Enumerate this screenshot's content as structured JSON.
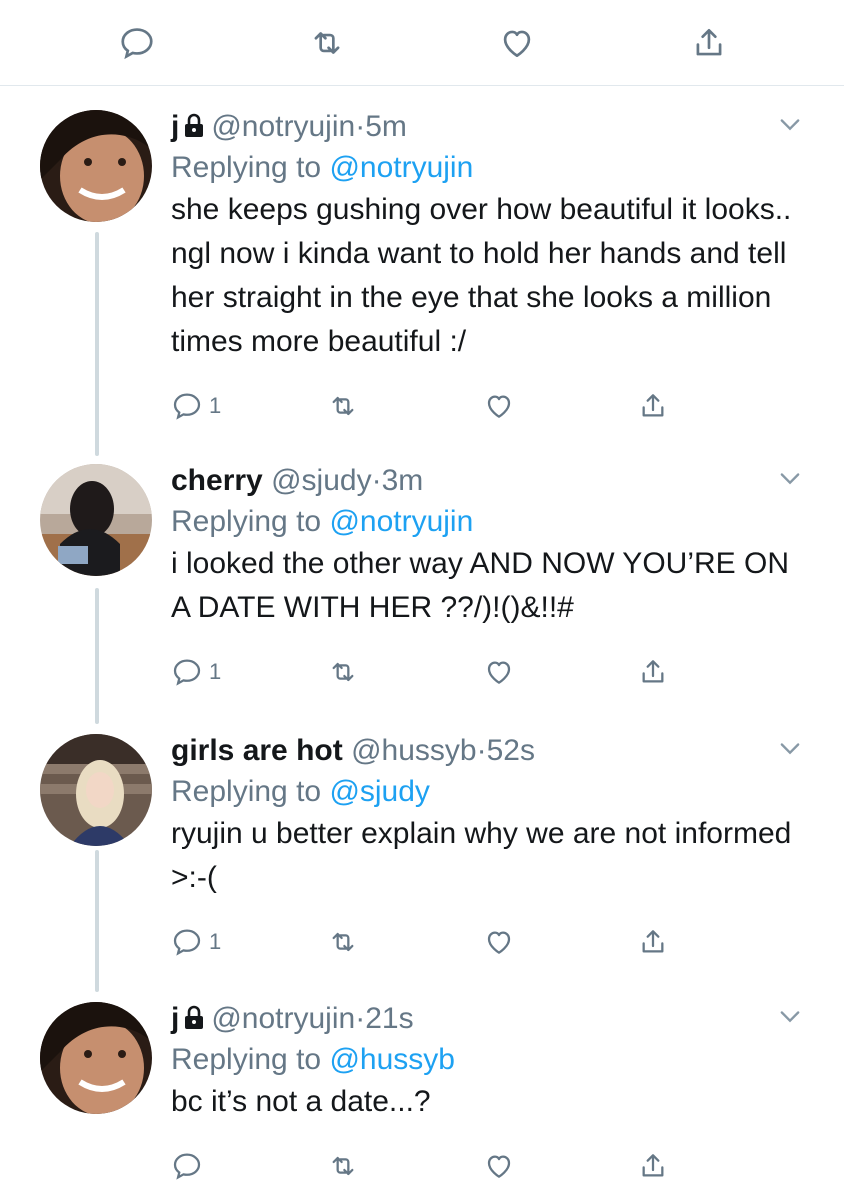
{
  "top_actions": {
    "reply_icon": "reply-icon",
    "retweet_icon": "retweet-icon",
    "like_icon": "heart-icon",
    "share_icon": "share-icon"
  },
  "colors": {
    "link": "#1da1f2",
    "secondary": "#657786",
    "primary": "#14171a",
    "thread_line": "#cfd9de"
  },
  "tweets": [
    {
      "name": "j",
      "protected": true,
      "handle": "@notryujin",
      "dot": "·",
      "time": "5m",
      "replying_label": "Replying to ",
      "replying_to": "@notryujin",
      "text": "she keeps gushing over how beautiful it looks.. ngl now i kinda want to hold her hands and tell her straight in the eye that she looks a million times more beautiful :/",
      "reply_count": "1"
    },
    {
      "name": "cherry",
      "protected": false,
      "handle": "@sjudy",
      "dot": "·",
      "time": "3m",
      "replying_label": "Replying to ",
      "replying_to": "@notryujin",
      "text": "i looked the other way AND NOW YOU’RE ON A DATE WITH HER ??/)!()&!!#",
      "reply_count": "1"
    },
    {
      "name": "girls are hot",
      "protected": false,
      "handle": "@hussyb",
      "dot": "·",
      "time": "52s",
      "replying_label": "Replying to ",
      "replying_to": "@sjudy",
      "text": "ryujin u better explain why we are not informed >:-(",
      "reply_count": "1"
    },
    {
      "name": "j",
      "protected": true,
      "handle": "@notryujin",
      "dot": "·",
      "time": "21s",
      "replying_label": "Replying to ",
      "replying_to": "@hussyb",
      "text": "bc it’s not a date...?",
      "reply_count": ""
    }
  ]
}
